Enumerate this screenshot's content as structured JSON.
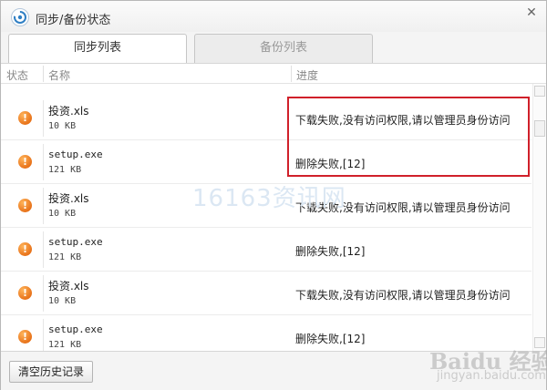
{
  "window": {
    "title": "同步/备份状态",
    "close_glyph": "✕"
  },
  "tabs": [
    {
      "label": "同步列表",
      "active": true
    },
    {
      "label": "备份列表",
      "active": false
    }
  ],
  "list": {
    "columns": {
      "status": "状态",
      "name": "名称",
      "progress": "进度"
    },
    "rows": [
      {
        "icon": "warning-icon",
        "icon_glyph": "!",
        "name": "投资.xls",
        "size": "10 KB",
        "status": "下载失败,没有访问权限,请以管理员身份访问"
      },
      {
        "icon": "warning-icon",
        "icon_glyph": "!",
        "name": "setup.exe",
        "size": "121 KB",
        "status": "删除失败,[12]"
      },
      {
        "icon": "warning-icon",
        "icon_glyph": "!",
        "name": "投资.xls",
        "size": "10 KB",
        "status": "下载失败,没有访问权限,请以管理员身份访问"
      },
      {
        "icon": "warning-icon",
        "icon_glyph": "!",
        "name": "setup.exe",
        "size": "121 KB",
        "status": "删除失败,[12]"
      },
      {
        "icon": "warning-icon",
        "icon_glyph": "!",
        "name": "投资.xls",
        "size": "10 KB",
        "status": "下载失败,没有访问权限,请以管理员身份访问"
      },
      {
        "icon": "warning-icon",
        "icon_glyph": "!",
        "name": "setup.exe",
        "size": "121 KB",
        "status": "删除失败,[12]"
      }
    ]
  },
  "footer": {
    "clear_history_label": "清空历史记录"
  },
  "watermarks": {
    "site": "16163资讯网",
    "baidu": "Baidu 经验",
    "baidu_sub": "jingyan.baidu.com"
  },
  "colors": {
    "highlight": "#d0202a",
    "warning": "#e8731a"
  }
}
